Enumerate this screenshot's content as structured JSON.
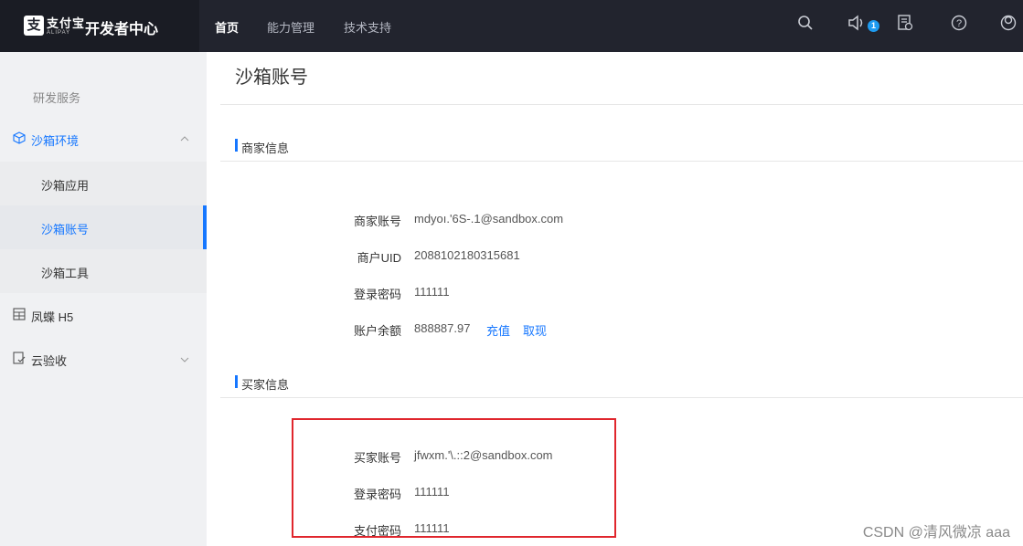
{
  "header": {
    "logo_mark": "支",
    "logo_cn": "支付宝",
    "logo_en": "ALIPAY",
    "title": "开发者中心",
    "nav": [
      "首页",
      "能力管理",
      "技术支持"
    ],
    "notice_count": "1",
    "icons": [
      "search-icon",
      "notification-icon",
      "document-icon",
      "help-icon",
      "user-icon"
    ]
  },
  "sidebar": {
    "group_label": "研发服务",
    "items": [
      {
        "label": "沙箱环境",
        "icon": "cube-icon",
        "expanded": true
      },
      {
        "label": "沙箱应用"
      },
      {
        "label": "沙箱账号",
        "active": true
      },
      {
        "label": "沙箱工具"
      },
      {
        "label": "凤蝶 H5",
        "icon": "grid-icon"
      },
      {
        "label": "云验收",
        "icon": "check-doc-icon",
        "expanded": false
      }
    ]
  },
  "main": {
    "title": "沙箱账号",
    "merchant": {
      "section_title": "商家信息",
      "fields": [
        {
          "label": "商家账号",
          "value": "mdyoı.'6S-.1@sandbox.com"
        },
        {
          "label": "商户UID",
          "value": "2088102180315681"
        },
        {
          "label": "登录密码",
          "value": "111111"
        },
        {
          "label": "账户余额",
          "value": "888887.97"
        }
      ],
      "actions": [
        "充值",
        "取现"
      ]
    },
    "buyer": {
      "section_title": "买家信息",
      "fields": [
        {
          "label": "买家账号",
          "value": "jfwxm.'\\.::2@sandbox.com"
        },
        {
          "label": "登录密码",
          "value": "111111"
        },
        {
          "label": "支付密码",
          "value": "111111"
        }
      ]
    }
  },
  "watermark": "CSDN @清风微凉 aaa",
  "colors": {
    "accent": "#1677ff",
    "topbar": "#22242e",
    "highlight_box": "#e0262d"
  }
}
